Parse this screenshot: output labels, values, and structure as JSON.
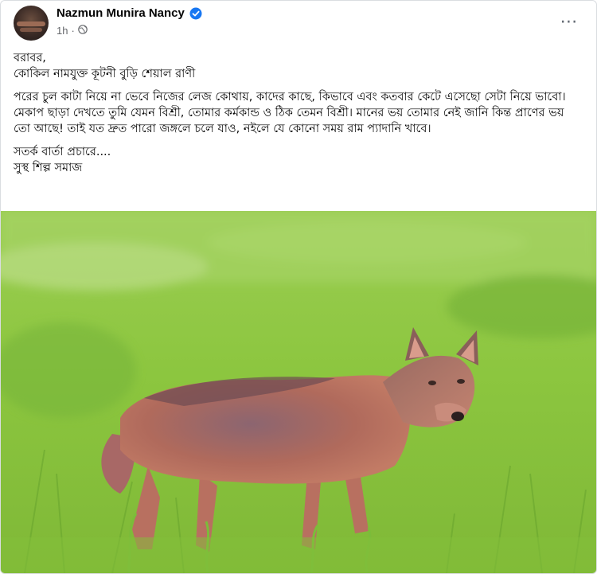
{
  "post": {
    "author": "Nazmun Munira Nancy",
    "time": "1h",
    "dot": "·",
    "privacy_icon": "globe-icon",
    "more_icon": "more-options-icon",
    "text": {
      "line1": "বরাবর,",
      "line2": "কোকিল নামযুক্ত কূটনী বুড়ি শেয়াল রাণী",
      "paragraph": "পরের চুল কাটা নিয়ে না ভেবে নিজের লেজ কোথায়, কাদের কাছে, কিভাবে এবং কতবার কেটে এসেছো সেটা নিয়ে ভাবো। মেকাপ ছাড়া দেখতে তুমি যেমন বিশ্রী, তোমার কর্মকান্ড ও ঠিক তেমন বিশ্রী। মানের ভয় তোমার নেই জানি কিন্ত প্রাণের ভয় তো আছে! তাই যত দ্রুত পারো জঙ্গলে চলে যাও, নইলে যে কোনো সময় রাম প্যাদানি খাবে।",
      "line3": "সতর্ক বার্তা প্রচারে....",
      "line4": "সুস্থ শিল্প সমাজ"
    },
    "image": {
      "subject": "jackal-in-grass",
      "colors": {
        "grass": "#8cc63f",
        "grass_dark": "#5f9a2a",
        "fur": "#b06a5c",
        "fur_dark": "#6e4b52"
      }
    }
  },
  "colors": {
    "accent": "#1877f2",
    "meta": "#65676b",
    "border": "#dadde1"
  }
}
